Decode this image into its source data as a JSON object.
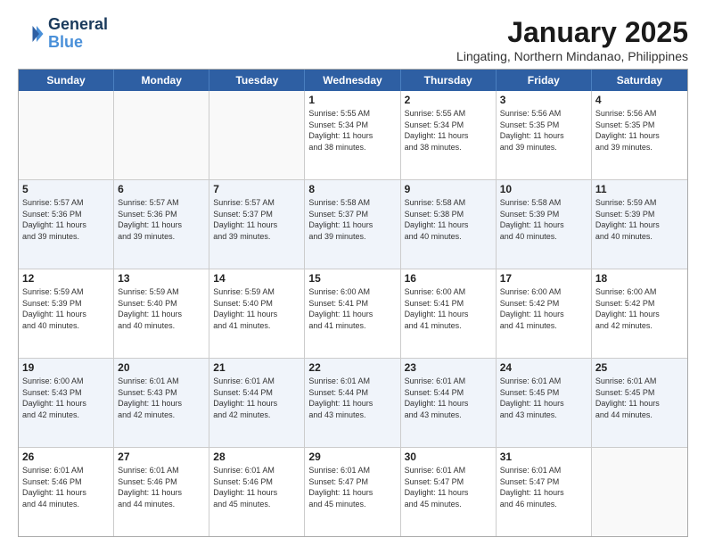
{
  "logo": {
    "text_general": "General",
    "text_blue": "Blue"
  },
  "title": "January 2025",
  "location": "Lingating, Northern Mindanao, Philippines",
  "days_of_week": [
    "Sunday",
    "Monday",
    "Tuesday",
    "Wednesday",
    "Thursday",
    "Friday",
    "Saturday"
  ],
  "weeks": [
    [
      {
        "day": "",
        "info": ""
      },
      {
        "day": "",
        "info": ""
      },
      {
        "day": "",
        "info": ""
      },
      {
        "day": "1",
        "info": "Sunrise: 5:55 AM\nSunset: 5:34 PM\nDaylight: 11 hours\nand 38 minutes."
      },
      {
        "day": "2",
        "info": "Sunrise: 5:55 AM\nSunset: 5:34 PM\nDaylight: 11 hours\nand 38 minutes."
      },
      {
        "day": "3",
        "info": "Sunrise: 5:56 AM\nSunset: 5:35 PM\nDaylight: 11 hours\nand 39 minutes."
      },
      {
        "day": "4",
        "info": "Sunrise: 5:56 AM\nSunset: 5:35 PM\nDaylight: 11 hours\nand 39 minutes."
      }
    ],
    [
      {
        "day": "5",
        "info": "Sunrise: 5:57 AM\nSunset: 5:36 PM\nDaylight: 11 hours\nand 39 minutes."
      },
      {
        "day": "6",
        "info": "Sunrise: 5:57 AM\nSunset: 5:36 PM\nDaylight: 11 hours\nand 39 minutes."
      },
      {
        "day": "7",
        "info": "Sunrise: 5:57 AM\nSunset: 5:37 PM\nDaylight: 11 hours\nand 39 minutes."
      },
      {
        "day": "8",
        "info": "Sunrise: 5:58 AM\nSunset: 5:37 PM\nDaylight: 11 hours\nand 39 minutes."
      },
      {
        "day": "9",
        "info": "Sunrise: 5:58 AM\nSunset: 5:38 PM\nDaylight: 11 hours\nand 40 minutes."
      },
      {
        "day": "10",
        "info": "Sunrise: 5:58 AM\nSunset: 5:39 PM\nDaylight: 11 hours\nand 40 minutes."
      },
      {
        "day": "11",
        "info": "Sunrise: 5:59 AM\nSunset: 5:39 PM\nDaylight: 11 hours\nand 40 minutes."
      }
    ],
    [
      {
        "day": "12",
        "info": "Sunrise: 5:59 AM\nSunset: 5:39 PM\nDaylight: 11 hours\nand 40 minutes."
      },
      {
        "day": "13",
        "info": "Sunrise: 5:59 AM\nSunset: 5:40 PM\nDaylight: 11 hours\nand 40 minutes."
      },
      {
        "day": "14",
        "info": "Sunrise: 5:59 AM\nSunset: 5:40 PM\nDaylight: 11 hours\nand 41 minutes."
      },
      {
        "day": "15",
        "info": "Sunrise: 6:00 AM\nSunset: 5:41 PM\nDaylight: 11 hours\nand 41 minutes."
      },
      {
        "day": "16",
        "info": "Sunrise: 6:00 AM\nSunset: 5:41 PM\nDaylight: 11 hours\nand 41 minutes."
      },
      {
        "day": "17",
        "info": "Sunrise: 6:00 AM\nSunset: 5:42 PM\nDaylight: 11 hours\nand 41 minutes."
      },
      {
        "day": "18",
        "info": "Sunrise: 6:00 AM\nSunset: 5:42 PM\nDaylight: 11 hours\nand 42 minutes."
      }
    ],
    [
      {
        "day": "19",
        "info": "Sunrise: 6:00 AM\nSunset: 5:43 PM\nDaylight: 11 hours\nand 42 minutes."
      },
      {
        "day": "20",
        "info": "Sunrise: 6:01 AM\nSunset: 5:43 PM\nDaylight: 11 hours\nand 42 minutes."
      },
      {
        "day": "21",
        "info": "Sunrise: 6:01 AM\nSunset: 5:44 PM\nDaylight: 11 hours\nand 42 minutes."
      },
      {
        "day": "22",
        "info": "Sunrise: 6:01 AM\nSunset: 5:44 PM\nDaylight: 11 hours\nand 43 minutes."
      },
      {
        "day": "23",
        "info": "Sunrise: 6:01 AM\nSunset: 5:44 PM\nDaylight: 11 hours\nand 43 minutes."
      },
      {
        "day": "24",
        "info": "Sunrise: 6:01 AM\nSunset: 5:45 PM\nDaylight: 11 hours\nand 43 minutes."
      },
      {
        "day": "25",
        "info": "Sunrise: 6:01 AM\nSunset: 5:45 PM\nDaylight: 11 hours\nand 44 minutes."
      }
    ],
    [
      {
        "day": "26",
        "info": "Sunrise: 6:01 AM\nSunset: 5:46 PM\nDaylight: 11 hours\nand 44 minutes."
      },
      {
        "day": "27",
        "info": "Sunrise: 6:01 AM\nSunset: 5:46 PM\nDaylight: 11 hours\nand 44 minutes."
      },
      {
        "day": "28",
        "info": "Sunrise: 6:01 AM\nSunset: 5:46 PM\nDaylight: 11 hours\nand 45 minutes."
      },
      {
        "day": "29",
        "info": "Sunrise: 6:01 AM\nSunset: 5:47 PM\nDaylight: 11 hours\nand 45 minutes."
      },
      {
        "day": "30",
        "info": "Sunrise: 6:01 AM\nSunset: 5:47 PM\nDaylight: 11 hours\nand 45 minutes."
      },
      {
        "day": "31",
        "info": "Sunrise: 6:01 AM\nSunset: 5:47 PM\nDaylight: 11 hours\nand 46 minutes."
      },
      {
        "day": "",
        "info": ""
      }
    ]
  ]
}
